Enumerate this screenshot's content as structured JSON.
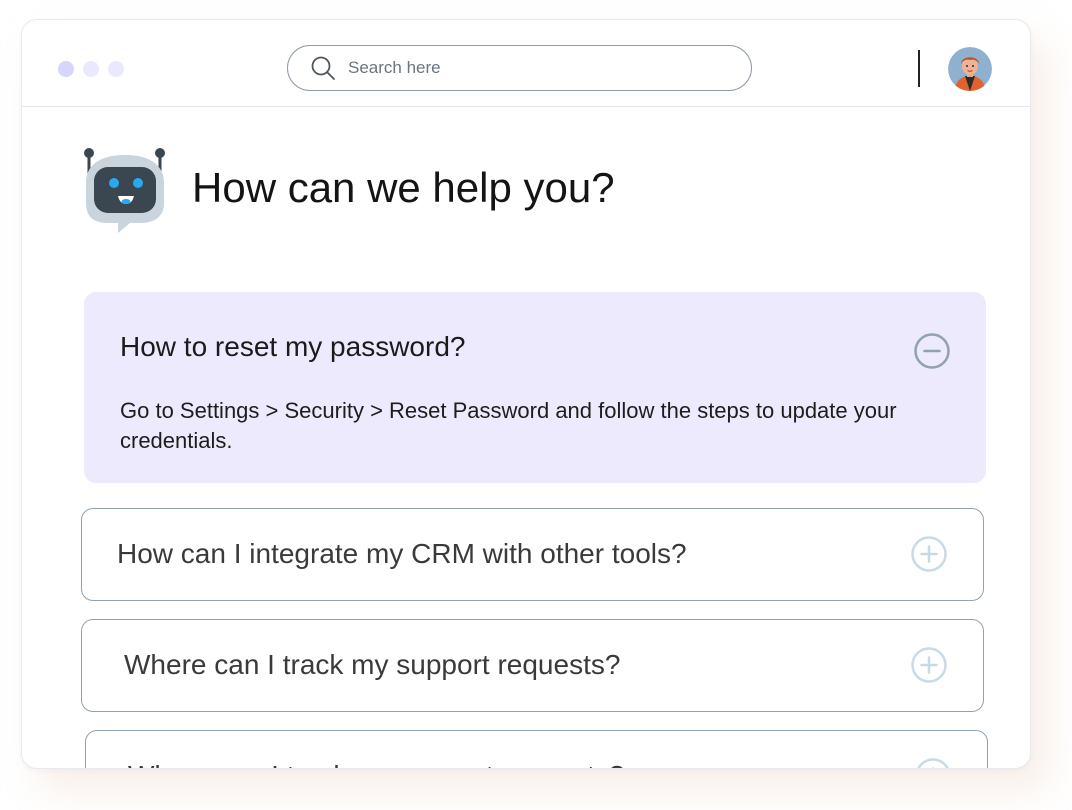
{
  "header": {
    "search": {
      "placeholder": "Search here",
      "value": ""
    }
  },
  "main": {
    "title": "How can we help you?",
    "faqs": [
      {
        "question": "How to reset my password?",
        "answer": "Go to Settings > Security > Reset Password and follow the steps to update your credentials.",
        "state": "expanded",
        "toggle_icon": "minus-circle-icon"
      },
      {
        "question": "How can I integrate my CRM with other tools?",
        "state": "collapsed",
        "toggle_icon": "plus-circle-icon"
      },
      {
        "question": "Where can I track my support requests?",
        "state": "collapsed",
        "toggle_icon": "plus-circle-icon"
      },
      {
        "question": "Where can I track my support requests?",
        "state": "collapsed",
        "toggle_icon": "plus-circle-icon"
      }
    ]
  },
  "colors": {
    "expanded_bg": "#edeafd",
    "card_border": "#8fa2b1",
    "toggle_open": "#8ea2b2",
    "toggle_closed": "#c7dbe6",
    "window_dot_active": "#d6d5fb",
    "window_dot_inactive": "#e9e8fd"
  }
}
